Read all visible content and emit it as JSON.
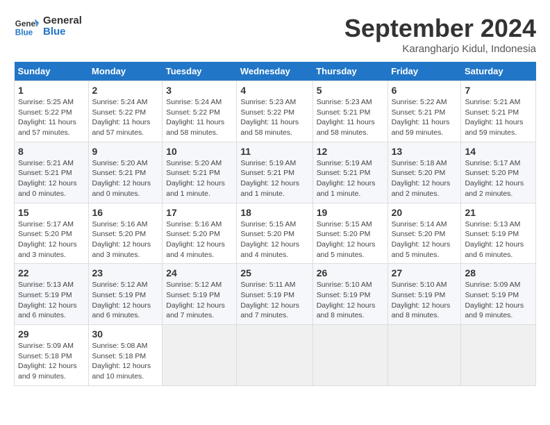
{
  "header": {
    "logo_line1": "General",
    "logo_line2": "Blue",
    "month": "September 2024",
    "location": "Karangharjo Kidul, Indonesia"
  },
  "weekdays": [
    "Sunday",
    "Monday",
    "Tuesday",
    "Wednesday",
    "Thursday",
    "Friday",
    "Saturday"
  ],
  "weeks": [
    [
      {
        "day": "1",
        "detail": "Sunrise: 5:25 AM\nSunset: 5:22 PM\nDaylight: 11 hours\nand 57 minutes."
      },
      {
        "day": "2",
        "detail": "Sunrise: 5:24 AM\nSunset: 5:22 PM\nDaylight: 11 hours\nand 57 minutes."
      },
      {
        "day": "3",
        "detail": "Sunrise: 5:24 AM\nSunset: 5:22 PM\nDaylight: 11 hours\nand 58 minutes."
      },
      {
        "day": "4",
        "detail": "Sunrise: 5:23 AM\nSunset: 5:22 PM\nDaylight: 11 hours\nand 58 minutes."
      },
      {
        "day": "5",
        "detail": "Sunrise: 5:23 AM\nSunset: 5:21 PM\nDaylight: 11 hours\nand 58 minutes."
      },
      {
        "day": "6",
        "detail": "Sunrise: 5:22 AM\nSunset: 5:21 PM\nDaylight: 11 hours\nand 59 minutes."
      },
      {
        "day": "7",
        "detail": "Sunrise: 5:21 AM\nSunset: 5:21 PM\nDaylight: 11 hours\nand 59 minutes."
      }
    ],
    [
      {
        "day": "8",
        "detail": "Sunrise: 5:21 AM\nSunset: 5:21 PM\nDaylight: 12 hours\nand 0 minutes."
      },
      {
        "day": "9",
        "detail": "Sunrise: 5:20 AM\nSunset: 5:21 PM\nDaylight: 12 hours\nand 0 minutes."
      },
      {
        "day": "10",
        "detail": "Sunrise: 5:20 AM\nSunset: 5:21 PM\nDaylight: 12 hours\nand 1 minute."
      },
      {
        "day": "11",
        "detail": "Sunrise: 5:19 AM\nSunset: 5:21 PM\nDaylight: 12 hours\nand 1 minute."
      },
      {
        "day": "12",
        "detail": "Sunrise: 5:19 AM\nSunset: 5:21 PM\nDaylight: 12 hours\nand 1 minute."
      },
      {
        "day": "13",
        "detail": "Sunrise: 5:18 AM\nSunset: 5:20 PM\nDaylight: 12 hours\nand 2 minutes."
      },
      {
        "day": "14",
        "detail": "Sunrise: 5:17 AM\nSunset: 5:20 PM\nDaylight: 12 hours\nand 2 minutes."
      }
    ],
    [
      {
        "day": "15",
        "detail": "Sunrise: 5:17 AM\nSunset: 5:20 PM\nDaylight: 12 hours\nand 3 minutes."
      },
      {
        "day": "16",
        "detail": "Sunrise: 5:16 AM\nSunset: 5:20 PM\nDaylight: 12 hours\nand 3 minutes."
      },
      {
        "day": "17",
        "detail": "Sunrise: 5:16 AM\nSunset: 5:20 PM\nDaylight: 12 hours\nand 4 minutes."
      },
      {
        "day": "18",
        "detail": "Sunrise: 5:15 AM\nSunset: 5:20 PM\nDaylight: 12 hours\nand 4 minutes."
      },
      {
        "day": "19",
        "detail": "Sunrise: 5:15 AM\nSunset: 5:20 PM\nDaylight: 12 hours\nand 5 minutes."
      },
      {
        "day": "20",
        "detail": "Sunrise: 5:14 AM\nSunset: 5:20 PM\nDaylight: 12 hours\nand 5 minutes."
      },
      {
        "day": "21",
        "detail": "Sunrise: 5:13 AM\nSunset: 5:19 PM\nDaylight: 12 hours\nand 6 minutes."
      }
    ],
    [
      {
        "day": "22",
        "detail": "Sunrise: 5:13 AM\nSunset: 5:19 PM\nDaylight: 12 hours\nand 6 minutes."
      },
      {
        "day": "23",
        "detail": "Sunrise: 5:12 AM\nSunset: 5:19 PM\nDaylight: 12 hours\nand 6 minutes."
      },
      {
        "day": "24",
        "detail": "Sunrise: 5:12 AM\nSunset: 5:19 PM\nDaylight: 12 hours\nand 7 minutes."
      },
      {
        "day": "25",
        "detail": "Sunrise: 5:11 AM\nSunset: 5:19 PM\nDaylight: 12 hours\nand 7 minutes."
      },
      {
        "day": "26",
        "detail": "Sunrise: 5:10 AM\nSunset: 5:19 PM\nDaylight: 12 hours\nand 8 minutes."
      },
      {
        "day": "27",
        "detail": "Sunrise: 5:10 AM\nSunset: 5:19 PM\nDaylight: 12 hours\nand 8 minutes."
      },
      {
        "day": "28",
        "detail": "Sunrise: 5:09 AM\nSunset: 5:19 PM\nDaylight: 12 hours\nand 9 minutes."
      }
    ],
    [
      {
        "day": "29",
        "detail": "Sunrise: 5:09 AM\nSunset: 5:18 PM\nDaylight: 12 hours\nand 9 minutes."
      },
      {
        "day": "30",
        "detail": "Sunrise: 5:08 AM\nSunset: 5:18 PM\nDaylight: 12 hours\nand 10 minutes."
      },
      {
        "day": "",
        "detail": ""
      },
      {
        "day": "",
        "detail": ""
      },
      {
        "day": "",
        "detail": ""
      },
      {
        "day": "",
        "detail": ""
      },
      {
        "day": "",
        "detail": ""
      }
    ]
  ]
}
